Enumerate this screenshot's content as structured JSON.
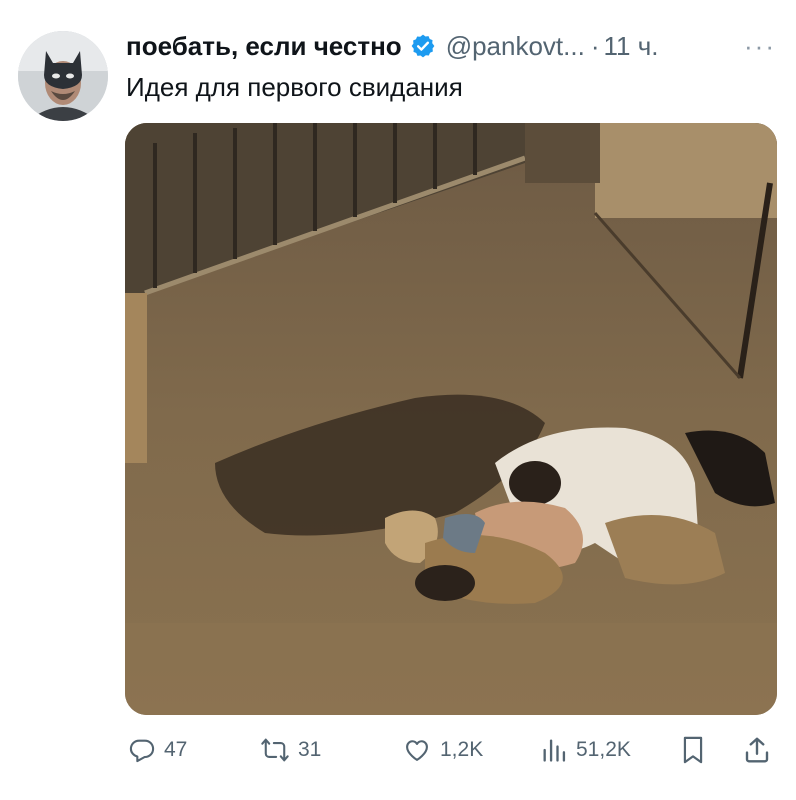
{
  "author": {
    "display_name": "поебать, если честно",
    "handle": "@pankovt...",
    "separator": "·",
    "time": "11 ч.",
    "verified": true,
    "verified_color": "#1d9bf0"
  },
  "tweet": {
    "text": "Идея для первого свидания"
  },
  "more_menu": {
    "icon": "more-dots-icon",
    "label": "···"
  },
  "actions": {
    "reply": {
      "icon": "reply-icon",
      "count": "47"
    },
    "retweet": {
      "icon": "retweet-icon",
      "count": "31"
    },
    "like": {
      "icon": "like-icon",
      "count": "1,2K"
    },
    "views": {
      "icon": "views-icon",
      "count": "51,2K"
    },
    "bookmark": {
      "icon": "bookmark-icon"
    },
    "share": {
      "icon": "share-icon"
    }
  },
  "colors": {
    "text_primary": "#0f1419",
    "text_secondary": "#536471"
  }
}
